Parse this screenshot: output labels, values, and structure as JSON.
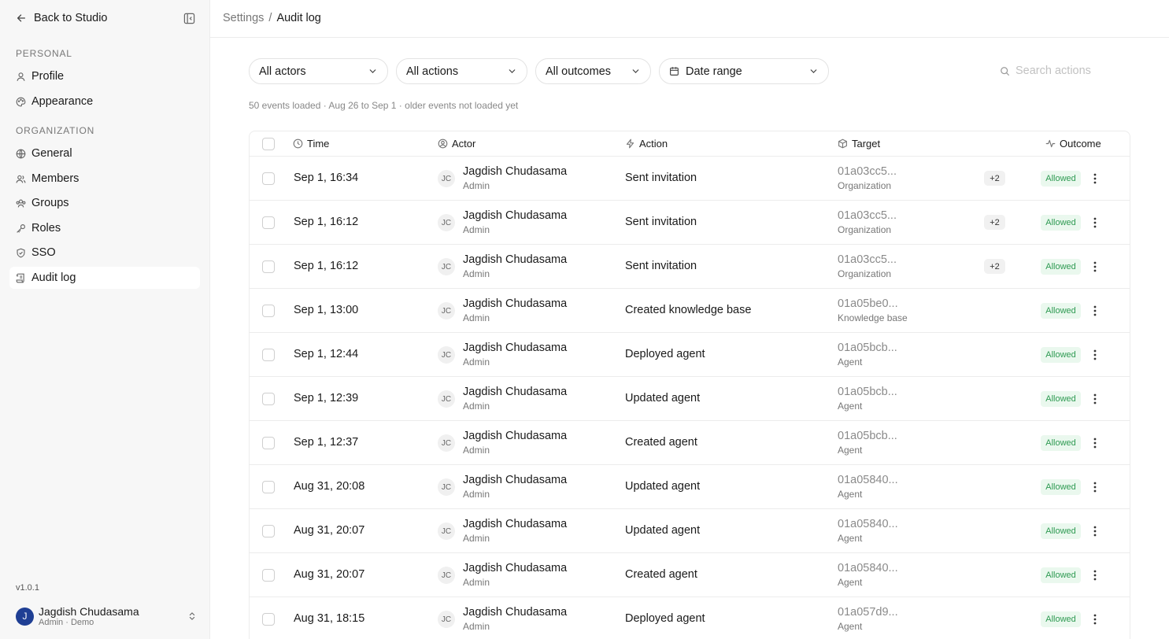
{
  "sidebar": {
    "back_label": "Back to Studio",
    "personal_label": "PERSONAL",
    "organization_label": "ORGANIZATION",
    "personal_items": [
      {
        "label": "Profile",
        "icon": "user-icon"
      },
      {
        "label": "Appearance",
        "icon": "palette-icon"
      }
    ],
    "org_items": [
      {
        "label": "General",
        "icon": "globe-icon"
      },
      {
        "label": "Members",
        "icon": "users-icon"
      },
      {
        "label": "Groups",
        "icon": "group-icon"
      },
      {
        "label": "Roles",
        "icon": "key-icon"
      },
      {
        "label": "SSO",
        "icon": "shield-icon"
      },
      {
        "label": "Audit log",
        "icon": "scroll-icon",
        "active": true
      }
    ],
    "version": "v1.0.1",
    "user": {
      "initial": "J",
      "name": "Jagdish Chudasama",
      "sub": "Admin · Demo"
    }
  },
  "header": {
    "breadcrumb_parent": "Settings",
    "breadcrumb_sep": "/",
    "breadcrumb_current": "Audit log"
  },
  "filters": {
    "actors": "All actors",
    "actions": "All actions",
    "outcomes": "All outcomes",
    "date_range": "Date range",
    "search_placeholder": "Search actions"
  },
  "meta_text": "50 events loaded · Aug 26 to Sep 1 · older events not loaded yet",
  "table": {
    "columns": {
      "time": "Time",
      "actor": "Actor",
      "action": "Action",
      "target": "Target",
      "outcome": "Outcome"
    },
    "rows": [
      {
        "time": "Sep 1, 16:34",
        "initials": "JC",
        "actor": "Jagdish Chudasama",
        "role": "Admin",
        "action": "Sent invitation",
        "target_id": "01a03cc5...",
        "target_type": "Organization",
        "extra": "+2",
        "outcome": "Allowed"
      },
      {
        "time": "Sep 1, 16:12",
        "initials": "JC",
        "actor": "Jagdish Chudasama",
        "role": "Admin",
        "action": "Sent invitation",
        "target_id": "01a03cc5...",
        "target_type": "Organization",
        "extra": "+2",
        "outcome": "Allowed"
      },
      {
        "time": "Sep 1, 16:12",
        "initials": "JC",
        "actor": "Jagdish Chudasama",
        "role": "Admin",
        "action": "Sent invitation",
        "target_id": "01a03cc5...",
        "target_type": "Organization",
        "extra": "+2",
        "outcome": "Allowed"
      },
      {
        "time": "Sep 1, 13:00",
        "initials": "JC",
        "actor": "Jagdish Chudasama",
        "role": "Admin",
        "action": "Created knowledge base",
        "target_id": "01a05be0...",
        "target_type": "Knowledge base",
        "outcome": "Allowed"
      },
      {
        "time": "Sep 1, 12:44",
        "initials": "JC",
        "actor": "Jagdish Chudasama",
        "role": "Admin",
        "action": "Deployed agent",
        "target_id": "01a05bcb...",
        "target_type": "Agent",
        "outcome": "Allowed"
      },
      {
        "time": "Sep 1, 12:39",
        "initials": "JC",
        "actor": "Jagdish Chudasama",
        "role": "Admin",
        "action": "Updated agent",
        "target_id": "01a05bcb...",
        "target_type": "Agent",
        "outcome": "Allowed"
      },
      {
        "time": "Sep 1, 12:37",
        "initials": "JC",
        "actor": "Jagdish Chudasama",
        "role": "Admin",
        "action": "Created agent",
        "target_id": "01a05bcb...",
        "target_type": "Agent",
        "outcome": "Allowed"
      },
      {
        "time": "Aug 31, 20:08",
        "initials": "JC",
        "actor": "Jagdish Chudasama",
        "role": "Admin",
        "action": "Updated agent",
        "target_id": "01a05840...",
        "target_type": "Agent",
        "outcome": "Allowed"
      },
      {
        "time": "Aug 31, 20:07",
        "initials": "JC",
        "actor": "Jagdish Chudasama",
        "role": "Admin",
        "action": "Updated agent",
        "target_id": "01a05840...",
        "target_type": "Agent",
        "outcome": "Allowed"
      },
      {
        "time": "Aug 31, 20:07",
        "initials": "JC",
        "actor": "Jagdish Chudasama",
        "role": "Admin",
        "action": "Created agent",
        "target_id": "01a05840...",
        "target_type": "Agent",
        "outcome": "Allowed"
      },
      {
        "time": "Aug 31, 18:15",
        "initials": "JC",
        "actor": "Jagdish Chudasama",
        "role": "Admin",
        "action": "Deployed agent",
        "target_id": "01a057d9...",
        "target_type": "Agent",
        "outcome": "Allowed"
      }
    ]
  }
}
